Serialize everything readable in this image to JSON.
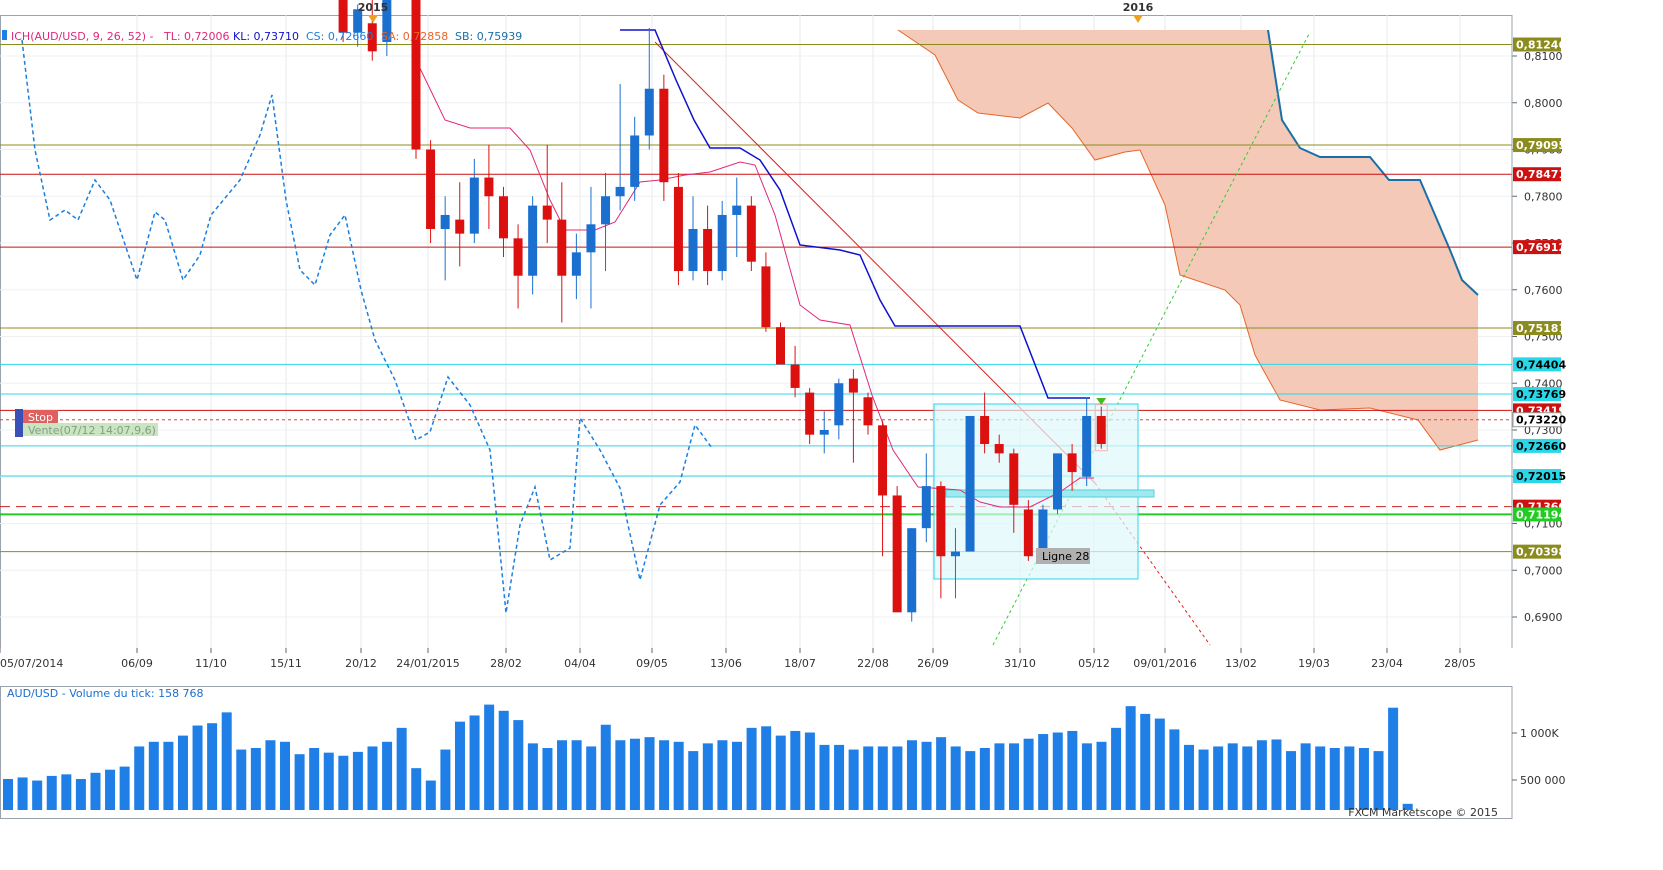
{
  "colors": {
    "bull": "#1a6fcf",
    "bear": "#dd1010",
    "tenkan": "#e0287a",
    "kijun": "#1010cc",
    "chikou": "#1a7fe0",
    "cloud_fill": "#f4c9b8",
    "cloud_edge": "#e8652a",
    "senkou_b": "#1a6fa8",
    "trend_red": "#e02020",
    "trend_green": "#33cc33",
    "olive": "#8c8c1e",
    "red_line": "#cc1111",
    "cyan": "#29d8e8",
    "green": "#22cc22",
    "volume": "#1f7fe6"
  },
  "header": {
    "year_markers": [
      "2015",
      "2016"
    ],
    "indicator": {
      "name": "ICH(AUD/USD, 9, 26, 52) -",
      "tl": "TL: 0,72006",
      "kl": "KL: 0,73710",
      "cs": "CS: 0,72660",
      "sa": "SA: 0,72858",
      "sb": "SB: 0,75939"
    }
  },
  "orders": {
    "stop_label": "Stop",
    "sell_label": "Vente(07/12 14:07,9,6)"
  },
  "annotations": {
    "ligne": "Ligne 28"
  },
  "volume_panel": {
    "title": "AUD/USD - Volume du tick: 158 768",
    "y_ticks": [
      "1 000K",
      "500 000"
    ],
    "copyright": "FXCM Marketscope © 2015"
  },
  "chart_data": {
    "type": "candlestick",
    "instrument": "AUD/USD",
    "timeframe": "weekly",
    "y_axis_ticks": [
      "0,8100",
      "0,8000",
      "0,7900",
      "0,7800",
      "0,7700",
      "0,7600",
      "0,7500",
      "0,7400",
      "0,7300",
      "0,7200",
      "0,7100",
      "0,7000",
      "0,6900"
    ],
    "x_axis_ticks": [
      "05/07/2014",
      "06/09",
      "11/10",
      "15/11",
      "20/12",
      "24/01/2015",
      "28/02",
      "04/04",
      "09/05",
      "13/06",
      "18/07",
      "22/08",
      "26/09",
      "31/10",
      "05/12",
      "09/01/2016",
      "13/02",
      "19/03",
      "23/04",
      "28/05"
    ],
    "price_lines": [
      {
        "label": "0,81246",
        "value": 0.81246,
        "color": "olive"
      },
      {
        "label": "0,79095",
        "value": 0.79095,
        "color": "olive"
      },
      {
        "label": "0,78471",
        "value": 0.78471,
        "color": "red_line"
      },
      {
        "label": "0,76912",
        "value": 0.76912,
        "color": "red_line"
      },
      {
        "label": "0,75181",
        "value": 0.75181,
        "color": "olive"
      },
      {
        "label": "0,74404",
        "value": 0.74404,
        "color": "cyan"
      },
      {
        "label": "0,73769",
        "value": 0.73769,
        "color": "cyan"
      },
      {
        "label": "0,73419",
        "value": 0.73419,
        "color": "red_line"
      },
      {
        "label": "0,73220",
        "value": 0.7322,
        "color": "price"
      },
      {
        "label": "0,72660",
        "value": 0.7266,
        "color": "cyan"
      },
      {
        "label": "0,72015",
        "value": 0.72015,
        "color": "cyan"
      },
      {
        "label": "0,71360",
        "value": 0.7136,
        "color": "red_dash"
      },
      {
        "label": "0,71194",
        "value": 0.71194,
        "color": "green"
      },
      {
        "label": "0,70398",
        "value": 0.70398,
        "color": "olive"
      }
    ],
    "candles": [
      {
        "x": "15/12/2014",
        "o": 0.824,
        "h": 0.826,
        "l": 0.813,
        "c": 0.815
      },
      {
        "x": "22/12/2014",
        "o": 0.815,
        "h": 0.821,
        "l": 0.812,
        "c": 0.82
      },
      {
        "x": "29/12/2014",
        "o": 0.817,
        "h": 0.823,
        "l": 0.809,
        "c": 0.811
      },
      {
        "x": "05/01/2015",
        "o": 0.813,
        "h": 0.825,
        "l": 0.81,
        "c": 0.824
      },
      {
        "x": "19/01/2015",
        "o": 0.825,
        "h": 0.826,
        "l": 0.788,
        "c": 0.79
      },
      {
        "x": "26/01/2015",
        "o": 0.79,
        "h": 0.792,
        "l": 0.77,
        "c": 0.773
      },
      {
        "x": "02/02/2015",
        "o": 0.773,
        "h": 0.78,
        "l": 0.762,
        "c": 0.776
      },
      {
        "x": "09/02/2015",
        "o": 0.775,
        "h": 0.783,
        "l": 0.765,
        "c": 0.772
      },
      {
        "x": "16/02/2015",
        "o": 0.772,
        "h": 0.788,
        "l": 0.77,
        "c": 0.784
      },
      {
        "x": "23/02/2015",
        "o": 0.784,
        "h": 0.791,
        "l": 0.773,
        "c": 0.78
      },
      {
        "x": "02/03/2015",
        "o": 0.78,
        "h": 0.782,
        "l": 0.767,
        "c": 0.771
      },
      {
        "x": "09/03/2015",
        "o": 0.771,
        "h": 0.774,
        "l": 0.756,
        "c": 0.763
      },
      {
        "x": "16/03/2015",
        "o": 0.763,
        "h": 0.78,
        "l": 0.759,
        "c": 0.778
      },
      {
        "x": "23/03/2015",
        "o": 0.778,
        "h": 0.791,
        "l": 0.77,
        "c": 0.775
      },
      {
        "x": "30/03/2015",
        "o": 0.775,
        "h": 0.783,
        "l": 0.753,
        "c": 0.763
      },
      {
        "x": "06/04/2015",
        "o": 0.763,
        "h": 0.772,
        "l": 0.758,
        "c": 0.768
      },
      {
        "x": "13/04/2015",
        "o": 0.768,
        "h": 0.782,
        "l": 0.756,
        "c": 0.774
      },
      {
        "x": "20/04/2015",
        "o": 0.774,
        "h": 0.785,
        "l": 0.764,
        "c": 0.78
      },
      {
        "x": "27/04/2015",
        "o": 0.78,
        "h": 0.804,
        "l": 0.777,
        "c": 0.782
      },
      {
        "x": "04/05/2015",
        "o": 0.782,
        "h": 0.797,
        "l": 0.779,
        "c": 0.793
      },
      {
        "x": "11/05/2015",
        "o": 0.793,
        "h": 0.816,
        "l": 0.79,
        "c": 0.803
      },
      {
        "x": "18/05/2015",
        "o": 0.803,
        "h": 0.806,
        "l": 0.779,
        "c": 0.783
      },
      {
        "x": "25/05/2015",
        "o": 0.782,
        "h": 0.785,
        "l": 0.761,
        "c": 0.764
      },
      {
        "x": "01/06/2015",
        "o": 0.764,
        "h": 0.78,
        "l": 0.762,
        "c": 0.773
      },
      {
        "x": "08/06/2015",
        "o": 0.773,
        "h": 0.778,
        "l": 0.761,
        "c": 0.764
      },
      {
        "x": "15/06/2015",
        "o": 0.764,
        "h": 0.779,
        "l": 0.762,
        "c": 0.776
      },
      {
        "x": "22/06/2015",
        "o": 0.776,
        "h": 0.784,
        "l": 0.767,
        "c": 0.778
      },
      {
        "x": "29/06/2015",
        "o": 0.778,
        "h": 0.78,
        "l": 0.764,
        "c": 0.766
      },
      {
        "x": "06/07/2015",
        "o": 0.765,
        "h": 0.768,
        "l": 0.751,
        "c": 0.752
      },
      {
        "x": "13/07/2015",
        "o": 0.752,
        "h": 0.753,
        "l": 0.744,
        "c": 0.744
      },
      {
        "x": "20/07/2015",
        "o": 0.744,
        "h": 0.748,
        "l": 0.737,
        "c": 0.739
      },
      {
        "x": "27/07/2015",
        "o": 0.738,
        "h": 0.739,
        "l": 0.727,
        "c": 0.729
      },
      {
        "x": "03/08/2015",
        "o": 0.729,
        "h": 0.734,
        "l": 0.725,
        "c": 0.73
      },
      {
        "x": "10/08/2015",
        "o": 0.731,
        "h": 0.741,
        "l": 0.728,
        "c": 0.74
      },
      {
        "x": "17/08/2015",
        "o": 0.741,
        "h": 0.743,
        "l": 0.723,
        "c": 0.738
      },
      {
        "x": "24/08/2015",
        "o": 0.737,
        "h": 0.738,
        "l": 0.729,
        "c": 0.731
      },
      {
        "x": "31/08/2015",
        "o": 0.731,
        "h": 0.732,
        "l": 0.703,
        "c": 0.716
      },
      {
        "x": "07/09/2015",
        "o": 0.716,
        "h": 0.718,
        "l": 0.691,
        "c": 0.691
      },
      {
        "x": "14/09/2015",
        "o": 0.691,
        "h": 0.709,
        "l": 0.689,
        "c": 0.709
      },
      {
        "x": "21/09/2015",
        "o": 0.709,
        "h": 0.725,
        "l": 0.706,
        "c": 0.718
      },
      {
        "x": "28/09/2015",
        "o": 0.718,
        "h": 0.719,
        "l": 0.694,
        "c": 0.703
      },
      {
        "x": "05/10/2015",
        "o": 0.703,
        "h": 0.709,
        "l": 0.694,
        "c": 0.704
      },
      {
        "x": "12/10/2015",
        "o": 0.704,
        "h": 0.733,
        "l": 0.704,
        "c": 0.733
      },
      {
        "x": "19/10/2015",
        "o": 0.733,
        "h": 0.738,
        "l": 0.725,
        "c": 0.727
      },
      {
        "x": "26/10/2015",
        "o": 0.727,
        "h": 0.729,
        "l": 0.723,
        "c": 0.725
      },
      {
        "x": "02/11/2015",
        "o": 0.725,
        "h": 0.726,
        "l": 0.708,
        "c": 0.714
      },
      {
        "x": "09/11/2015",
        "o": 0.713,
        "h": 0.715,
        "l": 0.702,
        "c": 0.703
      },
      {
        "x": "16/11/2015",
        "o": 0.704,
        "h": 0.714,
        "l": 0.704,
        "c": 0.713
      },
      {
        "x": "23/11/2015",
        "o": 0.713,
        "h": 0.725,
        "l": 0.712,
        "c": 0.725
      },
      {
        "x": "30/11/2015",
        "o": 0.725,
        "h": 0.727,
        "l": 0.717,
        "c": 0.721
      },
      {
        "x": "07/12/2015",
        "o": 0.72,
        "h": 0.737,
        "l": 0.718,
        "c": 0.733
      },
      {
        "x": "14/12/2015",
        "o": 0.733,
        "h": 0.735,
        "l": 0.726,
        "c": 0.727
      }
    ],
    "volume": [
      400,
      420,
      380,
      440,
      460,
      400,
      480,
      520,
      560,
      820,
      880,
      880,
      960,
      1090,
      1120,
      1260,
      780,
      800,
      900,
      880,
      720,
      800,
      740,
      700,
      750,
      820,
      880,
      1060,
      540,
      380,
      780,
      1140,
      1220,
      1360,
      1280,
      1160,
      860,
      800,
      900,
      900,
      820,
      1100,
      900,
      920,
      940,
      900,
      880,
      760,
      860,
      900,
      880,
      1060,
      1080,
      960,
      1020,
      1000,
      840,
      840,
      780,
      820,
      820,
      820,
      900,
      880,
      940,
      820,
      760,
      800,
      860,
      860,
      920,
      980,
      1000,
      1020,
      860,
      880,
      1060,
      1340,
      1240,
      1180,
      1040,
      840,
      780,
      820,
      860,
      820,
      900,
      910,
      760,
      860,
      820,
      800,
      820,
      800,
      760,
      1320,
      80
    ]
  }
}
